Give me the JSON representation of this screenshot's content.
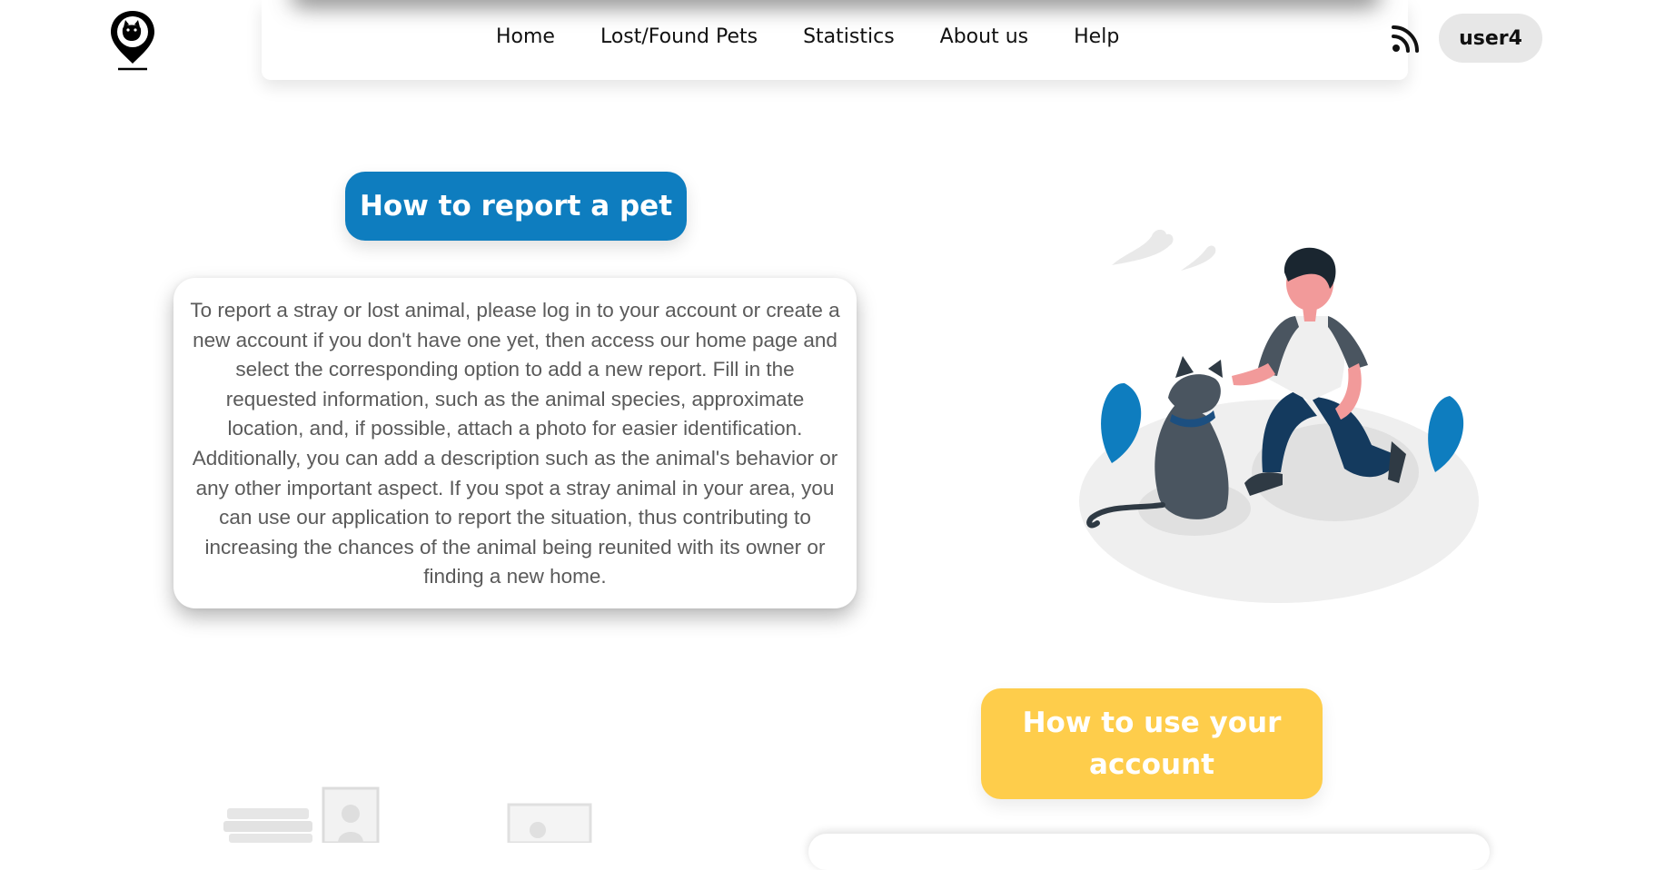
{
  "nav": {
    "items": [
      {
        "label": "Home"
      },
      {
        "label": "Lost/Found Pets"
      },
      {
        "label": "Statistics"
      },
      {
        "label": "About us"
      },
      {
        "label": "Help"
      }
    ]
  },
  "header": {
    "user_label": "user4"
  },
  "icons": {
    "logo": "pet-location-pin-logo",
    "feed": "rss-icon"
  },
  "section_report": {
    "title": "How to report a pet",
    "body": "To report a stray or lost animal, please log in to your account or create a new account if you don't have one yet, then access our home page and select the corresponding option to add a new report. Fill in the requested information, such as the animal species, approximate location, and, if possible, attach a photo for easier identification. Additionally, you can add a description such as the animal's behavior or any other important aspect. If you spot a stray animal in your area, you can use our application to report the situation, thus contributing to increasing the chances of the animal being reunited with its owner or finding a new home."
  },
  "section_account": {
    "title": "How to use your account"
  },
  "colors": {
    "blue": "#0e7dbf",
    "yellow": "#fecd4b",
    "pill": "#e7e7e7",
    "text": "#5a5a5a"
  }
}
